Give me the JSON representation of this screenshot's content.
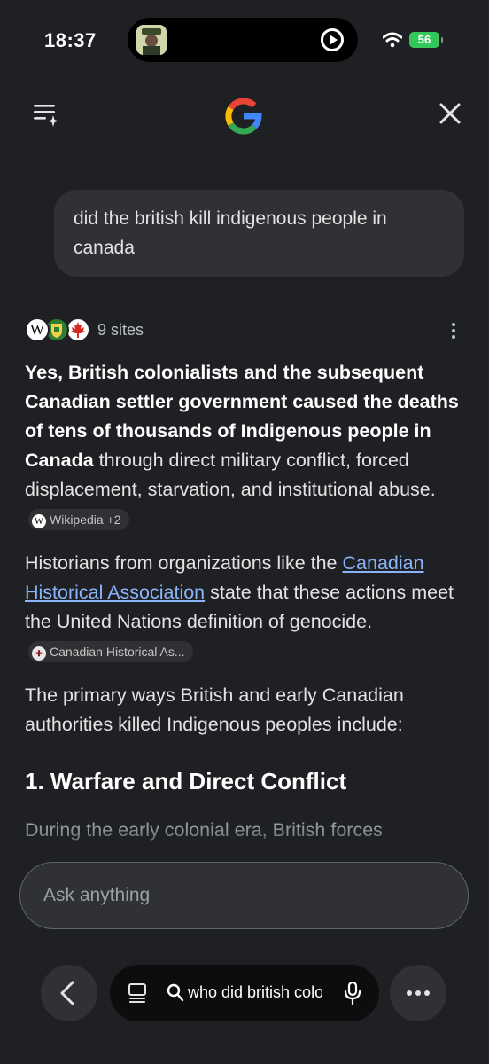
{
  "status_bar": {
    "time": "18:37",
    "battery": "56",
    "island_icons": [
      "avatar-icon",
      "play-icon"
    ]
  },
  "header": {
    "left_icon": "history-icon",
    "logo": "google-g-logo",
    "right_icon": "close-icon"
  },
  "query": "did the british kill indigenous people in canada",
  "sources": {
    "count_label": "9 sites",
    "icons": [
      "wikipedia-icon",
      "crest-icon",
      "maple-leaf-icon"
    ]
  },
  "answer": {
    "p1_bold": "Yes, British colonialists and the subsequent Canadian settler government caused the deaths of tens of thousands of Indigenous people in Canada",
    "p1_rest": " through direct military conflict, forced displacement, starvation, and institutional abuse.",
    "p1_chip": "Wikipedia +2",
    "p2_start": "Historians from organizations like the ",
    "p2_link": "Canadian Historical Association",
    "p2_rest": " state that these actions meet the United Nations definition of genocide.",
    "p2_chip": "Canadian Historical As...",
    "p3": "The primary ways British and early Canadian authorities killed Indigenous peoples include:",
    "heading": "1. Warfare and Direct Conflict",
    "p4": "During the early colonial era, British forces"
  },
  "ask_box": {
    "placeholder": "Ask anything"
  },
  "bottom_bar": {
    "url_text": "who did british colo",
    "accent": "#8ab4f8"
  }
}
